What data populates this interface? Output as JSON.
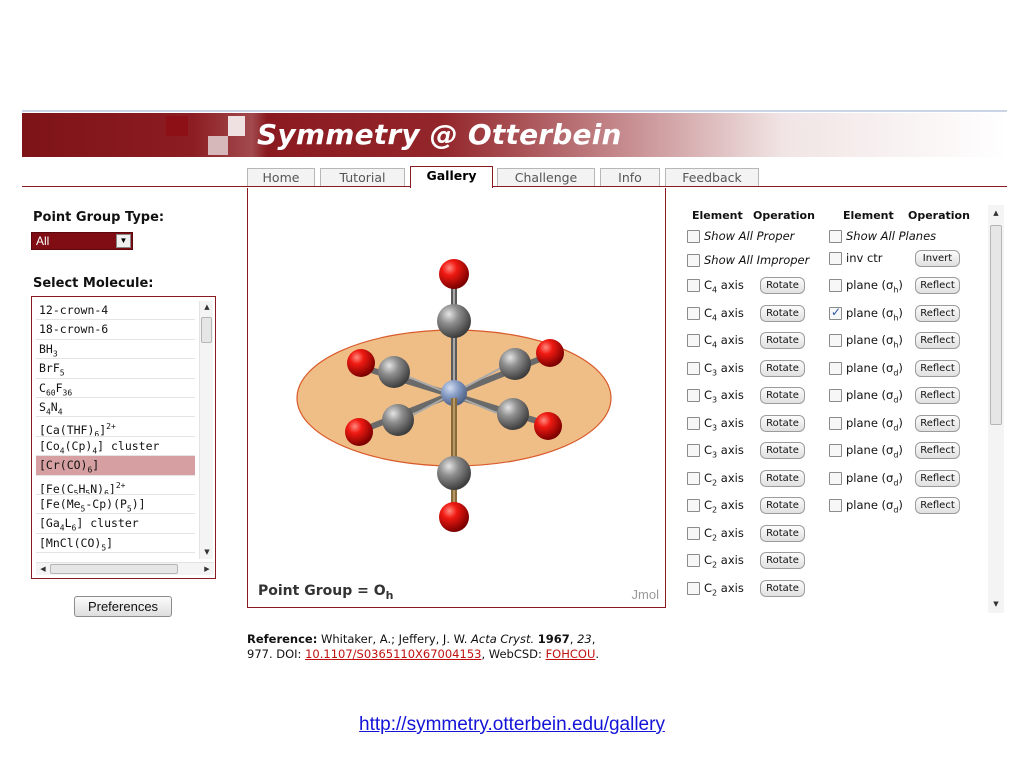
{
  "site": {
    "title": "Symmetry @ Otterbein"
  },
  "tabs": [
    {
      "label": "Home",
      "active": false
    },
    {
      "label": "Tutorial",
      "active": false
    },
    {
      "label": "Gallery",
      "active": true
    },
    {
      "label": "Challenge",
      "active": false
    },
    {
      "label": "Info",
      "active": false
    },
    {
      "label": "Feedback",
      "active": false
    }
  ],
  "left": {
    "point_group_type_label": "Point Group Type:",
    "point_group_type_value": "All",
    "select_molecule_label": "Select Molecule:",
    "molecules": [
      "12-crown-4",
      "18-crown-6",
      "BH<sub>3</sub>",
      "BrF<sub>5</sub>",
      "C<sub>60</sub>F<sub>36</sub>",
      "S<sub>4</sub>N<sub>4</sub>",
      "[Ca(THF)<sub>6</sub>]<sup>2+</sup>",
      "[Co<sub>4</sub>(Cp)<sub>4</sub>] cluster",
      "[Cr(CO)<sub>6</sub>]",
      "[Fe(C<sub>5</sub>H<sub>5</sub>N)<sub>6</sub>]<sup>2+</sup>",
      "[Fe(Me<sub>5</sub>-Cp)(P<sub>5</sub>)]",
      "[Ga<sub>4</sub>L<sub>6</sub>] cluster",
      "[MnCl(CO)<sub>5</sub>]"
    ],
    "selected_molecule": "[Cr(CO)<sub>6</sub>]",
    "preferences_label": "Preferences"
  },
  "viewer": {
    "point_group_prefix": "Point Group = ",
    "point_group_symbol": "O",
    "point_group_subscript": "h",
    "jmol_label": "Jmol"
  },
  "symmetry": {
    "headers": {
      "element": "Element",
      "operation": "Operation"
    },
    "show_all_proper": "Show All Proper",
    "show_all_improper": "Show All Improper",
    "show_all_planes": "Show All Planes",
    "proper": [
      {
        "label": "C<sub>4</sub> axis",
        "button": "Rotate",
        "checked": false
      },
      {
        "label": "C<sub>4</sub> axis",
        "button": "Rotate",
        "checked": false
      },
      {
        "label": "C<sub>4</sub> axis",
        "button": "Rotate",
        "checked": false
      },
      {
        "label": "C<sub>3</sub> axis",
        "button": "Rotate",
        "checked": false
      },
      {
        "label": "C<sub>3</sub> axis",
        "button": "Rotate",
        "checked": false
      },
      {
        "label": "C<sub>3</sub> axis",
        "button": "Rotate",
        "checked": false
      },
      {
        "label": "C<sub>3</sub> axis",
        "button": "Rotate",
        "checked": false
      },
      {
        "label": "C<sub>2</sub> axis",
        "button": "Rotate",
        "checked": false
      },
      {
        "label": "C<sub>2</sub> axis",
        "button": "Rotate",
        "checked": false
      },
      {
        "label": "C<sub>2</sub> axis",
        "button": "Rotate",
        "checked": false
      },
      {
        "label": "C<sub>2</sub> axis",
        "button": "Rotate",
        "checked": false
      },
      {
        "label": "C<sub>2</sub> axis",
        "button": "Rotate",
        "checked": false
      }
    ],
    "planes": [
      {
        "label": "inv ctr",
        "button": "Invert",
        "checked": false
      },
      {
        "label": "plane (σ<sub>h</sub>)",
        "button": "Reflect",
        "checked": false
      },
      {
        "label": "plane (σ<sub>h</sub>)",
        "button": "Reflect",
        "checked": true
      },
      {
        "label": "plane (σ<sub>h</sub>)",
        "button": "Reflect",
        "checked": false
      },
      {
        "label": "plane (σ<sub>d</sub>)",
        "button": "Reflect",
        "checked": false
      },
      {
        "label": "plane (σ<sub>d</sub>)",
        "button": "Reflect",
        "checked": false
      },
      {
        "label": "plane (σ<sub>d</sub>)",
        "button": "Reflect",
        "checked": false
      },
      {
        "label": "plane (σ<sub>d</sub>)",
        "button": "Reflect",
        "checked": false
      },
      {
        "label": "plane (σ<sub>d</sub>)",
        "button": "Reflect",
        "checked": false
      },
      {
        "label": "plane (σ<sub>d</sub>)",
        "button": "Reflect",
        "checked": false
      }
    ]
  },
  "reference": {
    "label": "Reference:",
    "authors": " Whitaker, A.; Jeffery, J. W. ",
    "journal": "Acta Cryst.",
    "year": "1967",
    "volume": "23",
    "pages": "977. DOI: ",
    "doi": "10.1107/S0365110X67004153",
    "webcsd_label": ", WebCSD: ",
    "webcsd": "FOHCOU"
  },
  "footer": {
    "url": "http://symmetry.otterbein.edu/gallery"
  },
  "colors": {
    "brand_maroon": "#8a1a1f",
    "oxygen": "#e0140f",
    "carbon": "#8e8e8e",
    "chromium": "#8a9fc6",
    "plane": "#e8a860"
  }
}
